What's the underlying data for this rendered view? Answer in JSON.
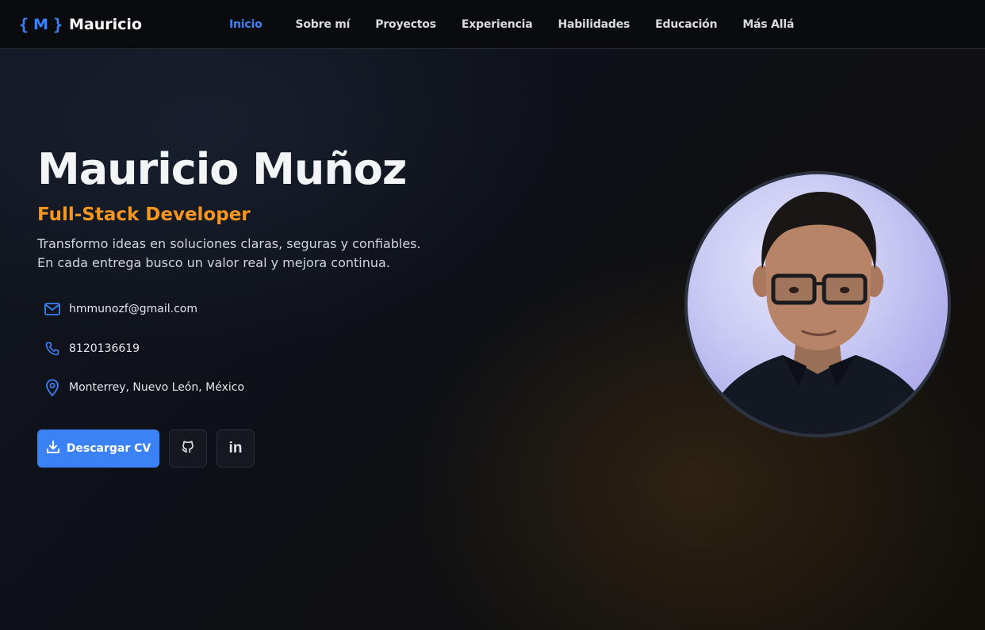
{
  "logo": {
    "open_brace": "{",
    "letter": "M",
    "close_brace": "}",
    "name": "Mauricio"
  },
  "nav": [
    {
      "label": "Inicio",
      "active": true
    },
    {
      "label": "Sobre mí",
      "active": false
    },
    {
      "label": "Proyectos",
      "active": false
    },
    {
      "label": "Experiencia",
      "active": false
    },
    {
      "label": "Habilidades",
      "active": false
    },
    {
      "label": "Educación",
      "active": false
    },
    {
      "label": "Más Allá",
      "active": false
    }
  ],
  "hero": {
    "name": "Mauricio Muñoz",
    "role": "Full-Stack Developer",
    "tagline_line1": "Transformo ideas en soluciones claras, seguras y confiables.",
    "tagline_line2": "En cada entrega busco un valor real y mejora continua."
  },
  "contact": [
    {
      "icon": "mail-icon",
      "text": "hmmunozf@gmail.com"
    },
    {
      "icon": "phone-icon",
      "text": "8120136619"
    },
    {
      "icon": "map-pin-icon",
      "text": "Monterrey, Nuevo León, México"
    }
  ],
  "actions": {
    "download_label": "Descargar CV",
    "github_icon": "github-icon",
    "linkedin_icon": "linkedin-icon",
    "linkedin_glyph": "in"
  },
  "colors": {
    "accent": "#3b82f6",
    "role": "#f5961f",
    "background": "#0d0f13"
  }
}
